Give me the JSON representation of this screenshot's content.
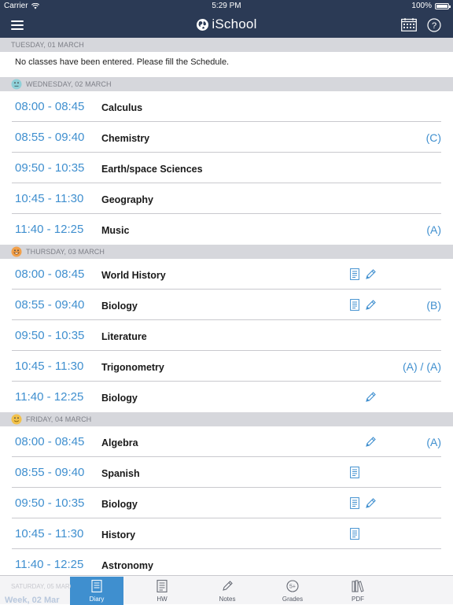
{
  "status": {
    "carrier": "Carrier",
    "time": "5:29 PM",
    "battery": "100%",
    "battery_level": 1.0
  },
  "nav": {
    "title": "iSchool",
    "menu_icon": "hamburger-icon",
    "calendar_icon": "calendar-icon",
    "help_icon": "help-icon"
  },
  "colors": {
    "nav_bg": "#2b3a55",
    "accent": "#3f8fcf",
    "header_bg": "#d6d7dc"
  },
  "days": [
    {
      "header": "TUESDAY, 01 MARCH",
      "notice": "No classes have been entered. Please fill the Schedule."
    },
    {
      "header": "WEDNESDAY, 02 MARCH",
      "face": "neutral",
      "lessons": [
        {
          "time": "08:00 - 08:45",
          "subject": "Calculus",
          "grade": ""
        },
        {
          "time": "08:55 - 09:40",
          "subject": "Chemistry",
          "grade": "(C)"
        },
        {
          "time": "09:50 - 10:35",
          "subject": "Earth/space Sciences",
          "grade": ""
        },
        {
          "time": "10:45 - 11:30",
          "subject": "Geography",
          "grade": ""
        },
        {
          "time": "11:40 - 12:25",
          "subject": "Music",
          "grade": "(A)"
        }
      ]
    },
    {
      "header": "THURSDAY, 03 MARCH",
      "face": "laughing",
      "lessons": [
        {
          "time": "08:00 - 08:45",
          "subject": "World History",
          "grade": "",
          "note": true,
          "homework": true
        },
        {
          "time": "08:55 - 09:40",
          "subject": "Biology",
          "grade": "(B)",
          "note": true,
          "homework": true
        },
        {
          "time": "09:50 - 10:35",
          "subject": "Literature",
          "grade": ""
        },
        {
          "time": "10:45 - 11:30",
          "subject": "Trigonometry",
          "grade": "(A) / (A)"
        },
        {
          "time": "11:40 - 12:25",
          "subject": "Biology",
          "grade": "",
          "homework": true
        }
      ]
    },
    {
      "header": "FRIDAY, 04 MARCH",
      "face": "smiling",
      "lessons": [
        {
          "time": "08:00 - 08:45",
          "subject": "Algebra",
          "grade": "(A)",
          "homework": true
        },
        {
          "time": "08:55 - 09:40",
          "subject": "Spanish",
          "grade": "",
          "note": true
        },
        {
          "time": "09:50 - 10:35",
          "subject": "Biology",
          "grade": "",
          "note": true,
          "homework": true
        },
        {
          "time": "10:45 - 11:30",
          "subject": "History",
          "grade": "",
          "note": true
        },
        {
          "time": "11:40 - 12:25",
          "subject": "Astronomy",
          "grade": ""
        }
      ]
    }
  ],
  "tabbar": {
    "ghost_header": "SATURDAY, 05 MARCH",
    "week_label": "Week, 02 Mar",
    "tabs": [
      {
        "label": "Diary",
        "icon": "diary-icon",
        "active": true
      },
      {
        "label": "HW",
        "icon": "homework-icon",
        "active": false
      },
      {
        "label": "Notes",
        "icon": "pencil-icon",
        "active": false
      },
      {
        "label": "Grades",
        "icon": "grades-icon",
        "active": false
      },
      {
        "label": "PDF",
        "icon": "pdf-icon",
        "active": false
      }
    ]
  }
}
